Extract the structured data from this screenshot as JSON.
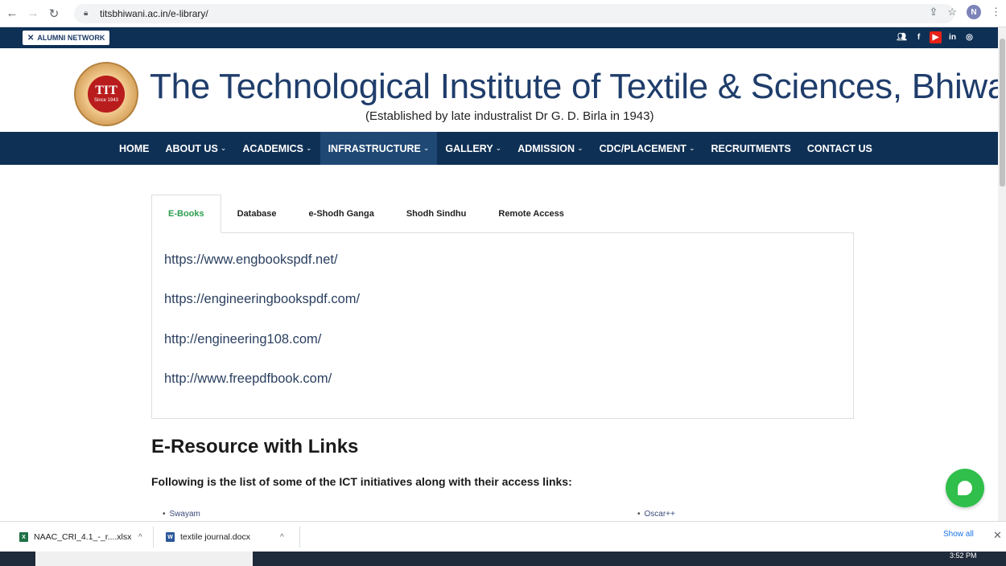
{
  "browser": {
    "url": "titsbhiwani.ac.in/e-library/",
    "profile_initial": "N"
  },
  "topstrip": {
    "alumni_label": "ALUMNI NETWORK",
    "social_icons": [
      "group-icon",
      "facebook-icon",
      "youtube-icon",
      "linkedin-icon",
      "instagram-icon"
    ]
  },
  "header": {
    "logo_text": "TIT",
    "logo_since": "Since 1943",
    "title": "The Technological Institute of Textile & Sciences, Bhiwani",
    "subtitle": "(Established by late industralist Dr G. D. Birla in 1943)"
  },
  "nav": {
    "items": [
      {
        "label": "HOME",
        "dropdown": false
      },
      {
        "label": "ABOUT US",
        "dropdown": true
      },
      {
        "label": "ACADEMICS",
        "dropdown": true
      },
      {
        "label": "INFRASTRUCTURE",
        "dropdown": true
      },
      {
        "label": "GALLERY",
        "dropdown": true
      },
      {
        "label": "ADMISSION",
        "dropdown": true
      },
      {
        "label": "CDC/PLACEMENT",
        "dropdown": true
      },
      {
        "label": "RECRUITMENTS",
        "dropdown": false
      },
      {
        "label": "CONTACT US",
        "dropdown": false
      }
    ],
    "active": "INFRASTRUCTURE"
  },
  "tabs": {
    "items": [
      "E-Books",
      "Database",
      "e-Shodh Ganga",
      "Shodh Sindhu",
      "Remote Access"
    ],
    "active": "E-Books"
  },
  "ebooks_links": [
    "https://www.engbookspdf.net/",
    "https://engineeringbookspdf.com/",
    "http://engineering108.com/",
    "http://www.freepdfbook.com/"
  ],
  "eresource": {
    "title": "E-Resource with Links",
    "description": "Following is the list of some of the ICT initiatives along with their access links:",
    "items": [
      "Swayam",
      "Oscar++"
    ]
  },
  "downloads": {
    "files": [
      "NAAC_CRI_4.1_-_r....xlsx",
      "textile journal.docx"
    ],
    "show_all": "Show all"
  },
  "taskbar": {
    "time": "3:52 PM"
  },
  "colors": {
    "navy": "#0f3055",
    "title_blue": "#1f3d6b",
    "active_tab_green": "#2e9e4e",
    "chat_green": "#2fbf4a"
  }
}
